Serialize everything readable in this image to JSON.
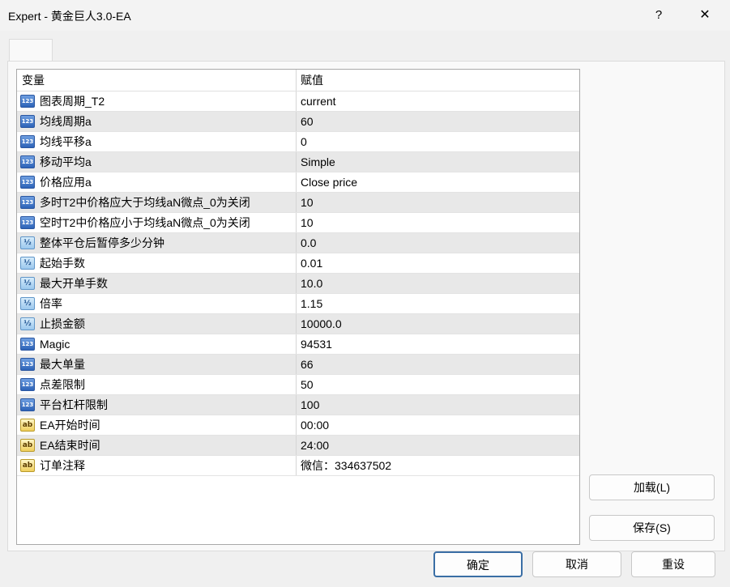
{
  "window": {
    "title": "Expert - 黄金巨人3.0-EA",
    "help_glyph": "?",
    "close_glyph": "✕"
  },
  "grid": {
    "headers": {
      "name": "变量",
      "value": "赋值"
    },
    "rows": [
      {
        "icon": "int",
        "icon_text": "123",
        "name": "图表周期_T2",
        "value": "current"
      },
      {
        "icon": "int",
        "icon_text": "123",
        "name": "均线周期a",
        "value": "60"
      },
      {
        "icon": "int",
        "icon_text": "123",
        "name": "均线平移a",
        "value": "0"
      },
      {
        "icon": "int",
        "icon_text": "123",
        "name": "移动平均a",
        "value": "Simple"
      },
      {
        "icon": "int",
        "icon_text": "123",
        "name": "价格应用a",
        "value": "Close price"
      },
      {
        "icon": "int",
        "icon_text": "123",
        "name": "多时T2中价格应大于均线aN微点_0为关闭",
        "value": "10"
      },
      {
        "icon": "int",
        "icon_text": "123",
        "name": "空时T2中价格应小于均线aN微点_0为关闭",
        "value": "10"
      },
      {
        "icon": "dbl",
        "icon_text": "½",
        "name": "整体平仓后暂停多少分钟",
        "value": "0.0"
      },
      {
        "icon": "dbl",
        "icon_text": "½",
        "name": "起始手数",
        "value": "0.01"
      },
      {
        "icon": "dbl",
        "icon_text": "½",
        "name": "最大开单手数",
        "value": "10.0"
      },
      {
        "icon": "dbl",
        "icon_text": "½",
        "name": "倍率",
        "value": "1.15"
      },
      {
        "icon": "dbl",
        "icon_text": "½",
        "name": "止损金额",
        "value": "10000.0"
      },
      {
        "icon": "int",
        "icon_text": "123",
        "name": "Magic",
        "value": "94531"
      },
      {
        "icon": "int",
        "icon_text": "123",
        "name": "最大单量",
        "value": "66"
      },
      {
        "icon": "int",
        "icon_text": "123",
        "name": "点差限制",
        "value": "50"
      },
      {
        "icon": "int",
        "icon_text": "123",
        "name": "平台杠杆限制",
        "value": "100"
      },
      {
        "icon": "str",
        "icon_text": "ab",
        "name": "EA开始时间",
        "value": "00:00"
      },
      {
        "icon": "str",
        "icon_text": "ab",
        "name": "EA结束时间",
        "value": "24:00"
      },
      {
        "icon": "str",
        "icon_text": "ab",
        "name": "订单注释",
        "value": "微信：334637502"
      }
    ]
  },
  "buttons": {
    "load": "加载(L)",
    "save": "保存(S)",
    "ok": "确定",
    "cancel": "取消",
    "reset": "重设"
  }
}
